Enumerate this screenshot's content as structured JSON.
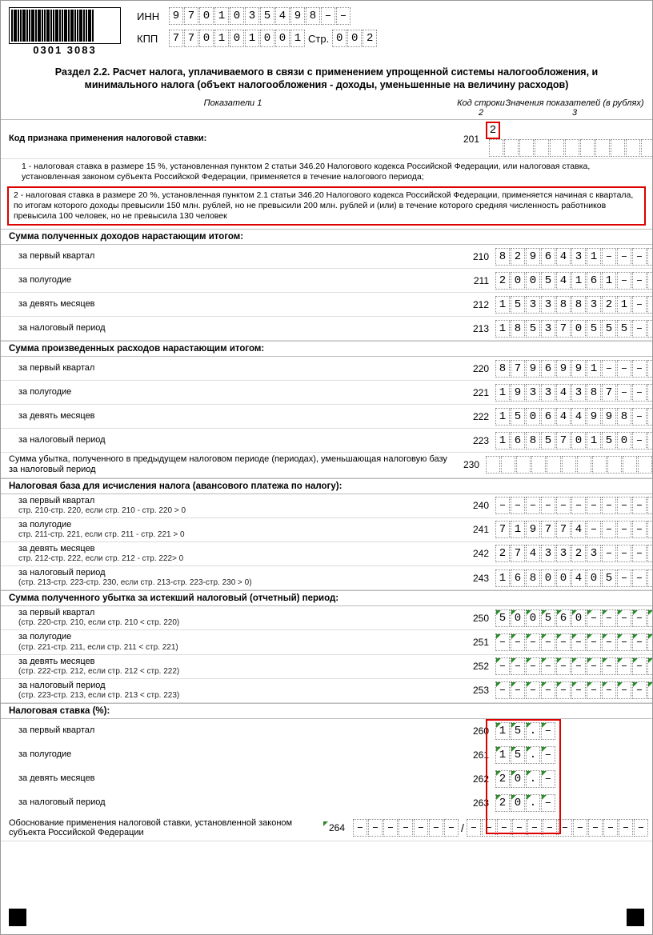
{
  "barcode_number": "0301 3083",
  "inn_label": "ИНН",
  "kpp_label": "КПП",
  "str_label": "Стр.",
  "inn": [
    "9",
    "7",
    "0",
    "1",
    "0",
    "3",
    "5",
    "4",
    "9",
    "8",
    "–",
    "–"
  ],
  "kpp": [
    "7",
    "7",
    "0",
    "1",
    "0",
    "1",
    "0",
    "0",
    "1"
  ],
  "page_no": [
    "0",
    "0",
    "2"
  ],
  "title": "Раздел 2.2. Расчет налога, уплачиваемого в связи с применением упрощенной системы налогообложения, и минимального налога (объект налогообложения - доходы, уменьшенные на величину расходов)",
  "cols": {
    "c1": "Показатели\n1",
    "c2": "Код строки\n2",
    "c3": "Значения показателей (в рублях)\n3"
  },
  "s201": {
    "head": "Код признака применения налоговой ставки:",
    "code": "201",
    "value": "2",
    "note1": "1 - налоговая ставка в размере 15 %, установленная пунктом 2 статьи 346.20 Налогового кодекса Российской Федерации, или налоговая ставка, установленная законом субъекта Российской Федерации, применяется в течение налогового периода;",
    "note2": "2 - налоговая ставка в размере 20 %, установленная пунктом 2.1 статьи 346.20 Налогового кодекса Российской Федерации, применяется начиная с квартала, по итогам которого доходы превысили 150 млн. рублей, но не превысили 200 млн. рублей и (или) в течение которого средняя численность работников превысила 100 человек, но не превысила 130 человек"
  },
  "income_head": "Сумма полученных доходов нарастающим итогом:",
  "expense_head": "Сумма произведенных расходов нарастающим итогом:",
  "loss_prev": {
    "label": "Сумма убытка, полученного в предыдущем налоговом периоде (периодах), уменьшающая налоговую базу за налоговый период",
    "code": "230"
  },
  "base_head": "Налоговая база для исчисления налога (авансового платежа по налогу):",
  "curr_loss_head": "Сумма полученного убытка за истекший налоговый (отчетный) период:",
  "rate_head": "Налоговая ставка (%):",
  "rows_income": [
    {
      "label": "за первый квартал",
      "code": "210",
      "v": [
        "8",
        "2",
        "9",
        "6",
        "4",
        "3",
        "1",
        "–",
        "–",
        "–",
        "–",
        "–"
      ]
    },
    {
      "label": "за полугодие",
      "code": "211",
      "v": [
        "2",
        "0",
        "0",
        "5",
        "4",
        "1",
        "6",
        "1",
        "–",
        "–",
        "–",
        "–"
      ]
    },
    {
      "label": "за девять месяцев",
      "code": "212",
      "v": [
        "1",
        "5",
        "3",
        "3",
        "8",
        "8",
        "3",
        "2",
        "1",
        "–",
        "–",
        "–"
      ]
    },
    {
      "label": "за налоговый период",
      "code": "213",
      "v": [
        "1",
        "8",
        "5",
        "3",
        "7",
        "0",
        "5",
        "5",
        "5",
        "–",
        "–",
        "–"
      ]
    }
  ],
  "rows_expense": [
    {
      "label": "за первый квартал",
      "code": "220",
      "v": [
        "8",
        "7",
        "9",
        "6",
        "9",
        "9",
        "1",
        "–",
        "–",
        "–",
        "–",
        "–"
      ]
    },
    {
      "label": "за полугодие",
      "code": "221",
      "v": [
        "1",
        "9",
        "3",
        "3",
        "4",
        "3",
        "8",
        "7",
        "–",
        "–",
        "–",
        "–"
      ]
    },
    {
      "label": "за девять месяцев",
      "code": "222",
      "v": [
        "1",
        "5",
        "0",
        "6",
        "4",
        "4",
        "9",
        "9",
        "8",
        "–",
        "–",
        "–"
      ]
    },
    {
      "label": "за налоговый период",
      "code": "223",
      "v": [
        "1",
        "6",
        "8",
        "5",
        "7",
        "0",
        "1",
        "5",
        "0",
        "–",
        "–",
        "–"
      ]
    }
  ],
  "rows_base": [
    {
      "label": "за первый квартал",
      "sub": "стр. 210-стр. 220, если стр. 210 - стр. 220 > 0",
      "code": "240",
      "v": [
        "–",
        "–",
        "–",
        "–",
        "–",
        "–",
        "–",
        "–",
        "–",
        "–",
        "–",
        "–"
      ]
    },
    {
      "label": "за полугодие",
      "sub": "стр. 211-стр. 221, если стр. 211 - стр. 221 > 0",
      "code": "241",
      "v": [
        "7",
        "1",
        "9",
        "7",
        "7",
        "4",
        "–",
        "–",
        "–",
        "–",
        "–",
        "–"
      ]
    },
    {
      "label": "за девять месяцев",
      "sub": "стр. 212-стр. 222, если стр. 212 - стр. 222> 0",
      "code": "242",
      "v": [
        "2",
        "7",
        "4",
        "3",
        "3",
        "2",
        "3",
        "–",
        "–",
        "–",
        "–",
        "–"
      ]
    },
    {
      "label": "за налоговый период",
      "sub": "(стр. 213-стр. 223-стр. 230, если стр. 213-стр. 223-стр. 230 > 0)",
      "code": "243",
      "v": [
        "1",
        "6",
        "8",
        "0",
        "0",
        "4",
        "0",
        "5",
        "–",
        "–",
        "–",
        "–"
      ]
    }
  ],
  "rows_curr_loss": [
    {
      "label": "за первый квартал",
      "sub": "(стр. 220-стр. 210, если стр. 210 < стр. 220)",
      "code": "250",
      "v": [
        "5",
        "0",
        "0",
        "5",
        "6",
        "0",
        "–",
        "–",
        "–",
        "–",
        "–",
        "–"
      ],
      "green": true
    },
    {
      "label": "за полугодие",
      "sub": "(стр. 221-стр. 211, если стр. 211 < стр. 221)",
      "code": "251",
      "v": [
        "–",
        "–",
        "–",
        "–",
        "–",
        "–",
        "–",
        "–",
        "–",
        "–",
        "–",
        "–"
      ],
      "green": true
    },
    {
      "label": "за девять месяцев",
      "sub": "(стр. 222-стр. 212, если стр. 212 < стр. 222)",
      "code": "252",
      "v": [
        "–",
        "–",
        "–",
        "–",
        "–",
        "–",
        "–",
        "–",
        "–",
        "–",
        "–",
        "–"
      ],
      "green": true
    },
    {
      "label": "за налоговый период",
      "sub": "(стр. 223-стр. 213, если стр. 213 < стр. 223)",
      "code": "253",
      "v": [
        "–",
        "–",
        "–",
        "–",
        "–",
        "–",
        "–",
        "–",
        "–",
        "–",
        "–",
        "–"
      ],
      "green": true
    }
  ],
  "rows_rate": [
    {
      "label": "за первый квартал",
      "code": "260",
      "v": [
        "1",
        "5",
        ".",
        "–"
      ],
      "green": true
    },
    {
      "label": "за полугодие",
      "code": "261",
      "v": [
        "1",
        "5",
        ".",
        "–"
      ],
      "green": true
    },
    {
      "label": "за девять месяцев",
      "code": "262",
      "v": [
        "2",
        "0",
        ".",
        "–"
      ],
      "green": true
    },
    {
      "label": "за налоговый период",
      "code": "263",
      "v": [
        "2",
        "0",
        ".",
        "–"
      ],
      "green": true
    }
  ],
  "row264": {
    "label": "Обоснование применения налоговой ставки, установленной законом субъекта Российской Федерации",
    "code": "264",
    "left": [
      "–",
      "–",
      "–",
      "–",
      "–",
      "–",
      "–"
    ],
    "right": [
      "–",
      "–",
      "–",
      "–",
      "–",
      "–",
      "–",
      "–",
      "–",
      "–",
      "–",
      "–"
    ]
  },
  "empty12": [
    "",
    "",
    "",
    "",
    "",
    "",
    "",
    "",
    "",
    "",
    "",
    ""
  ]
}
